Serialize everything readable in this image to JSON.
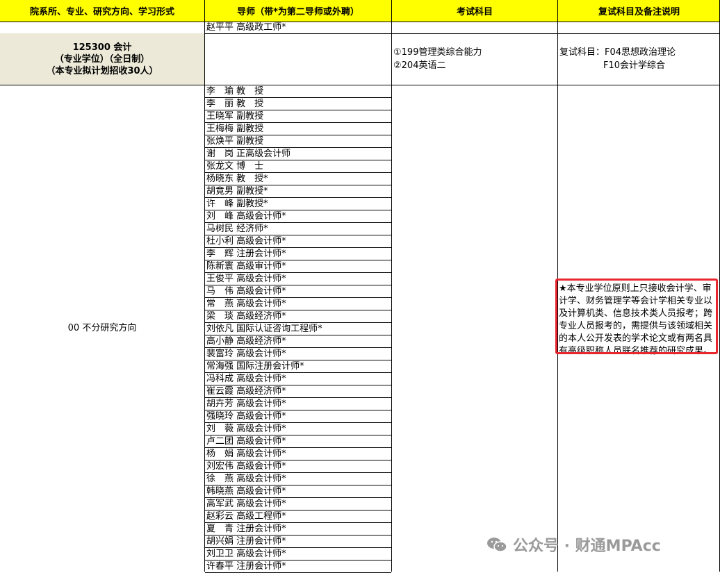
{
  "header": {
    "col1": "院系所、专业、研究方向、学习形式",
    "col2": "导师（带*为第二导师或外聘）",
    "col3": "考试科目",
    "col4": "复试科目及备注说明"
  },
  "top_row_advisor": "赵平平 高级政工师*",
  "major": {
    "line1": "125300 会计",
    "line2": "（专业学位）（全日制）",
    "line3": "（本专业拟计划招收30人）"
  },
  "exam_subjects": [
    "①199管理类综合能力",
    "②204英语二"
  ],
  "retest": {
    "line1": "复试科目：F04思想政治理论",
    "line2": "F10会计学综合"
  },
  "direction": "00 不分研究方向",
  "advisors": [
    "李　瑜 教　授",
    "李　丽 教　授",
    "王晓军 副教授",
    "王梅梅 副教授",
    "张焕平 副教授",
    "谢　岗 正高级会计师",
    "张龙文 博　士",
    "杨晓东 教　授*",
    "胡竟男 副教授*",
    "许　峰 副教授*",
    "刘　峰 高级会计师*",
    "马树民 经济师*",
    "杜小利 高级会计师*",
    "李　辉 注册会计师*",
    "陈新寰 高级审计师*",
    "王俊平 高级会计师*",
    "马　伟 高级会计师*",
    "常　燕 高级会计师*",
    "梁　琰 高级经济师*",
    "刘依凡 国际认证咨询工程师*",
    "高小静 高级经济师*",
    "裴富玲 高级会计师*",
    "常海强 国际注册会计师*",
    "冯科成 高级会计师*",
    "崔云霞 高级经济师*",
    "胡卉芳 高级会计师*",
    "强晓玲 高级会计师*",
    "刘　薇 高级会计师*",
    "卢二团 高级会计师*",
    "杨　娟 高级会计师*",
    "刘宏伟 高级会计师*",
    "徐　燕 高级会计师*",
    "韩晓燕 高级会计师*",
    "高军武 高级会计师*",
    "赵彩云 高级工程师*",
    "夏　青 注册会计师*",
    "胡兴娟 注册会计师*",
    "刘卫卫 高级会计师*",
    "许春平 注册会计师*"
  ],
  "note": "★本专业学位原则上只接收会计学、审计学、财务管理学等会计学相关专业以及计算机类、信息技术类人员报考；跨专业人员报考的，需提供与该领域相关的本人公开发表的学术论文或有两名具有高级职称人员联名推荐的研究成果。",
  "colors": {
    "header_bg": "#ffff00",
    "major_bg": "#ece9d8",
    "note_border": "#e8262e"
  },
  "watermark": {
    "icon": "wechat-icon",
    "text": "公众号 · 财通MPAcc"
  }
}
